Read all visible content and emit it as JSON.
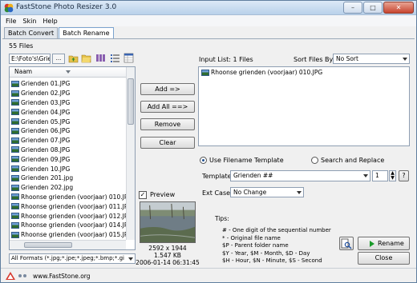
{
  "window": {
    "title": "FastStone Photo Resizer 3.0"
  },
  "menu": [
    "File",
    "Skin",
    "Help"
  ],
  "tabs": [
    "Batch Convert",
    "Batch Rename"
  ],
  "browser": {
    "count": "55 Files",
    "path": "E:\\Foto's\\Grier",
    "browse_label": "...",
    "column_header": "Naam",
    "files": [
      "Grienden 01.JPG",
      "Grienden 02.JPG",
      "Grienden 03.JPG",
      "Grienden 04.JPG",
      "Grienden 05.JPG",
      "Grienden 06.JPG",
      "Grienden 07.JPG",
      "Grienden 08.JPG",
      "Grienden 09.JPG",
      "Grienden 10.JPG",
      "Grienden 201.jpg",
      "Grienden 202.jpg",
      "Rhoonse grienden (voorjaar) 010.JPG",
      "Rhoonse grienden (voorjaar) 011.JPG",
      "Rhoonse grienden (voorjaar) 012.JPG",
      "Rhoonse grienden (voorjaar) 014.JPG",
      "Rhoonse grienden (voorjaar) 015.JPG"
    ],
    "filter": "All Formats (*.jpg;*.jpe;*.jpeg;*.bmp;*.gi"
  },
  "actions": {
    "add": "Add =>",
    "add_all": "Add All ==>",
    "remove": "Remove",
    "clear": "Clear"
  },
  "preview": {
    "label": "Preview",
    "dimensions": "2592 x 1944",
    "size": "1.547 KB",
    "datetime": "2006-01-14 06:31:45"
  },
  "input_list": {
    "label": "Input List:  1 Files",
    "sort_label": "Sort Files By:",
    "sort_value": "No Sort",
    "items": [
      "Rhoonse grienden (voorjaar) 010.JPG"
    ]
  },
  "rename": {
    "use_template": "Use Filename Template",
    "search_replace": "Search and Replace",
    "template_label": "Template:",
    "template_value": "Grienden ##",
    "start_number": "1",
    "help": "?",
    "ext_label": "Ext Case:",
    "ext_value": "No Change"
  },
  "tips": {
    "label": "Tips:",
    "lines": [
      "#   - One digit of the sequential number",
      "*   - Original file name",
      "$P - Parent folder name",
      "$Y - Year,       $M - Month,      $D - Day",
      "$H - Hour,       $N - Minute,    $S - Second"
    ]
  },
  "buttons": {
    "rename": "Rename",
    "close": "Close"
  },
  "status": {
    "site": "www.FastStone.org"
  }
}
